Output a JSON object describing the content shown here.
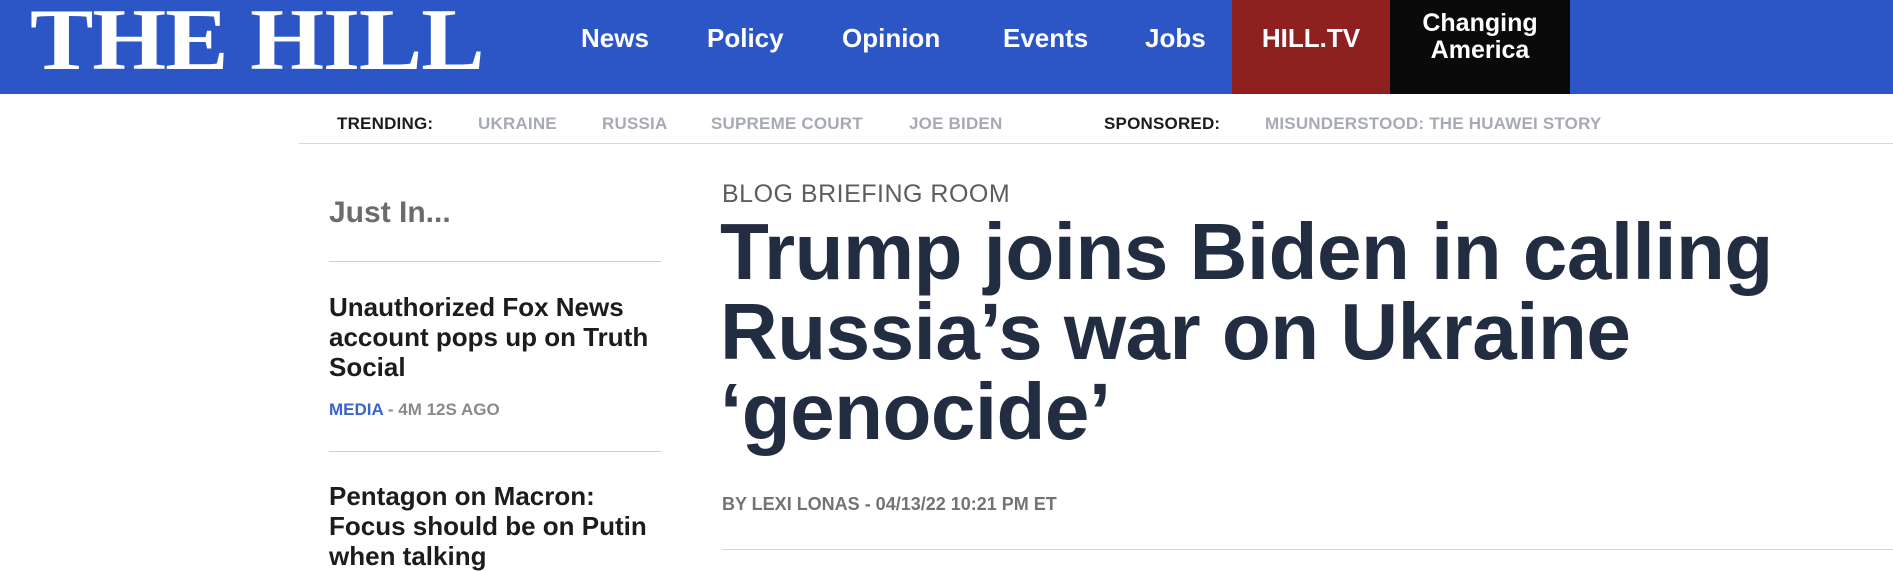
{
  "header": {
    "logo": "THE HILL",
    "nav": [
      "News",
      "Policy",
      "Opinion",
      "Events",
      "Jobs"
    ],
    "hilltv": "HILL.TV",
    "changing_line1": "Changing",
    "changing_line2": "America",
    "colors": {
      "bar": "#2c56c5",
      "hilltv": "#8e2020",
      "changing": "#0a0a0a"
    }
  },
  "trending": {
    "label": "TRENDING:",
    "items": [
      "UKRAINE",
      "RUSSIA",
      "SUPREME COURT",
      "JOE BIDEN"
    ],
    "sponsored_label": "SPONSORED:",
    "sponsored_item": "MISUNDERSTOOD: THE HUAWEI STORY"
  },
  "sidebar": {
    "title": "Just In...",
    "stories": [
      {
        "headline": "Unauthorized Fox News account pops up on Truth Social",
        "category": "MEDIA",
        "separator": " - ",
        "time": "4M 12S AGO"
      },
      {
        "headline": "Pentagon on Macron: Focus should be on Putin when talking"
      }
    ]
  },
  "article": {
    "kicker": "BLOG BRIEFING ROOM",
    "headline": "Trump joins Biden in calling Russia’s war on Ukraine ‘genocide’",
    "byline": "BY LEXI LONAS - 04/13/22 10:21 PM ET"
  }
}
